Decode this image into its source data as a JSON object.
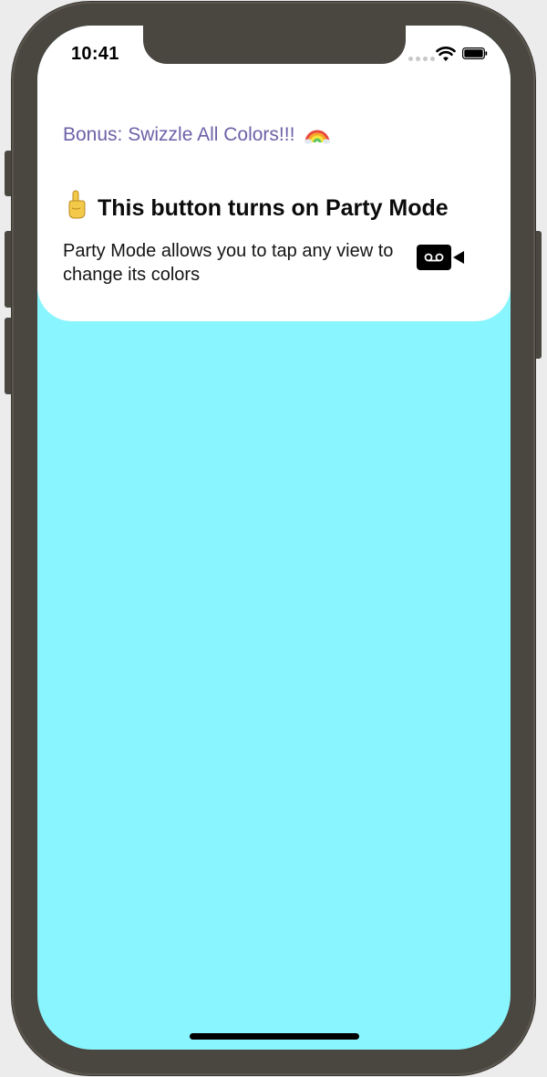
{
  "status_bar": {
    "time": "10:41"
  },
  "card": {
    "bonus_link": "Bonus: Swizzle All Colors!!!",
    "headline": "This button turns on Party Mode",
    "description": "Party Mode allows you to tap any view to change its colors"
  },
  "icons": {
    "rainbow": "rainbow-emoji",
    "pointing": "pointing-up-emoji",
    "record": "video-camera-icon"
  },
  "colors": {
    "background_content": "#89f5fe",
    "card_background": "#ffffff",
    "link": "#6d62a8",
    "frame": "#4a4640"
  }
}
